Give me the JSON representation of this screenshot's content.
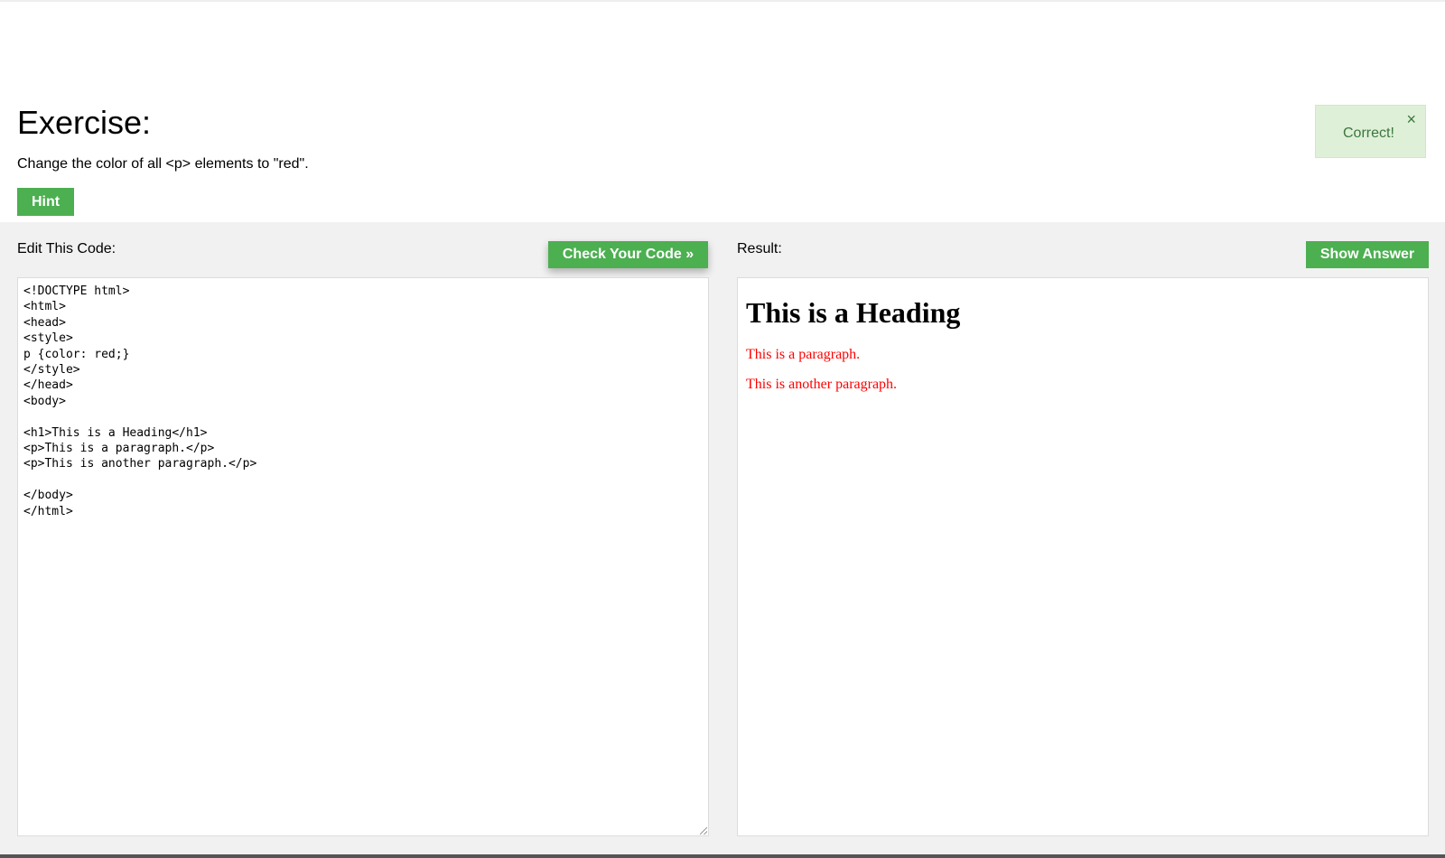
{
  "exercise": {
    "title": "Exercise:",
    "description": "Change the color of all <p> elements to \"red\".",
    "hint_label": "Hint"
  },
  "notification": {
    "text": "Correct!",
    "close_glyph": "×",
    "background": "#dff0d8",
    "text_color": "#3c763d"
  },
  "editor": {
    "label": "Edit This Code:",
    "check_label": "Check Your Code »",
    "code": "<!DOCTYPE html>\n<html>\n<head>\n<style>\np {color: red;}\n</style>\n</head>\n<body>\n\n<h1>This is a Heading</h1>\n<p>This is a paragraph.</p>\n<p>This is another paragraph.</p>\n\n</body>\n</html>"
  },
  "result": {
    "label": "Result:",
    "show_answer_label": "Show Answer",
    "heading": "This is a Heading",
    "paragraphs": [
      "This is a paragraph.",
      "This is another paragraph."
    ],
    "paragraph_color": "#ff0000"
  },
  "colors": {
    "accent": "#4caf50",
    "work_area_bg": "#f1f1f1"
  }
}
